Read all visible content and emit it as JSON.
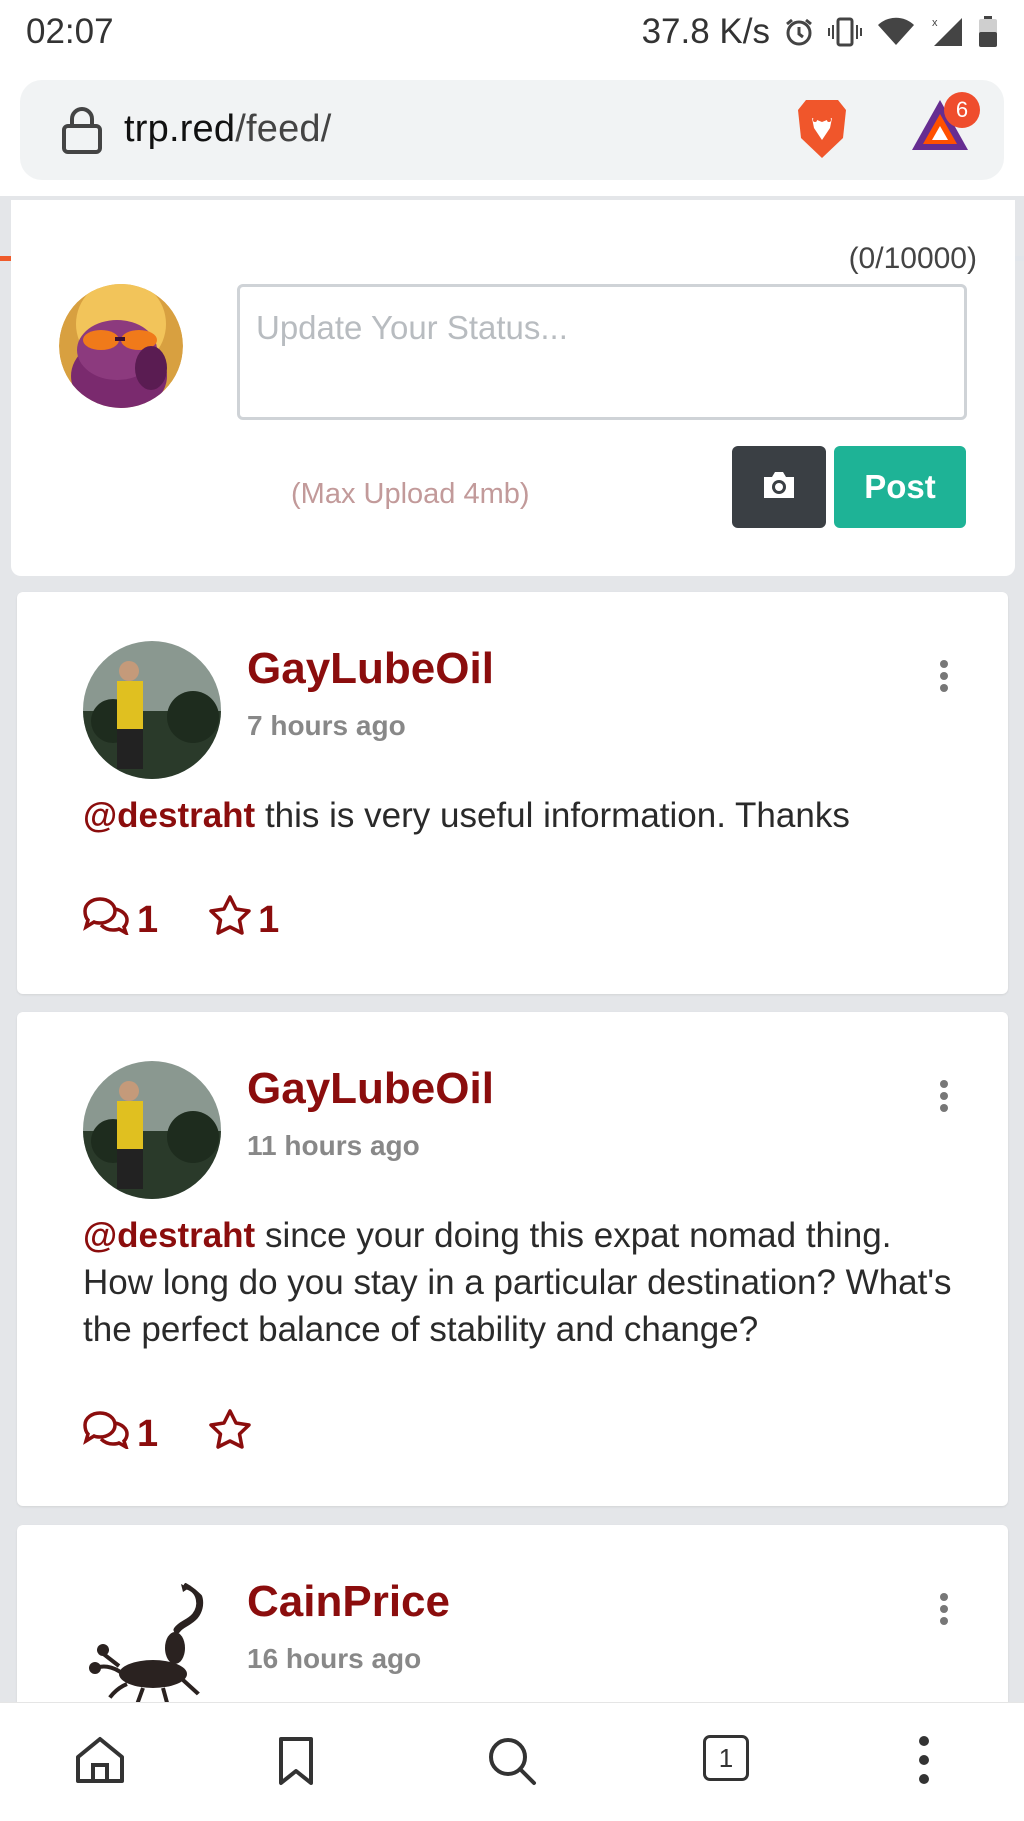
{
  "status_bar": {
    "time": "02:07",
    "net_speed": "37.8 K/s",
    "icons": [
      "alarm-icon",
      "vibrate-icon",
      "wifi-icon",
      "signal-icon",
      "battery-icon"
    ]
  },
  "browser": {
    "url_domain": "trp.red",
    "url_path": "/feed/",
    "rewards_badge_count": "6",
    "load_progress": 0.8,
    "colors": {
      "progress": "#ef5b2b",
      "brave": "#f0562b"
    }
  },
  "composer": {
    "char_counter": "(0/10000)",
    "placeholder": "Update Your Status...",
    "value": "",
    "max_upload": "(Max Upload 4mb)",
    "post_label": "Post",
    "colors": {
      "post": "#1eb396",
      "camera": "#3a3f44"
    }
  },
  "feed": [
    {
      "username": "GayLubeOil",
      "time": "7 hours ago",
      "mention": "@destraht",
      "text": " this is very useful information. Thanks",
      "comments": "1",
      "stars": "1"
    },
    {
      "username": "GayLubeOil",
      "time": "11 hours ago",
      "mention": "@destraht",
      "text": " since your doing this expat nomad thing. How long do you stay in a particular destination? What's the perfect balance of stability and change?",
      "comments": "1",
      "stars": ""
    },
    {
      "username": "CainPrice",
      "time": "16 hours ago"
    }
  ],
  "bottom_nav": {
    "tab_count": "1",
    "icons": [
      "home-icon",
      "bookmark-icon",
      "search-icon",
      "tabs-icon",
      "more-icon"
    ]
  },
  "theme": {
    "username_color": "#8b0d0d",
    "time_color": "#888888"
  }
}
